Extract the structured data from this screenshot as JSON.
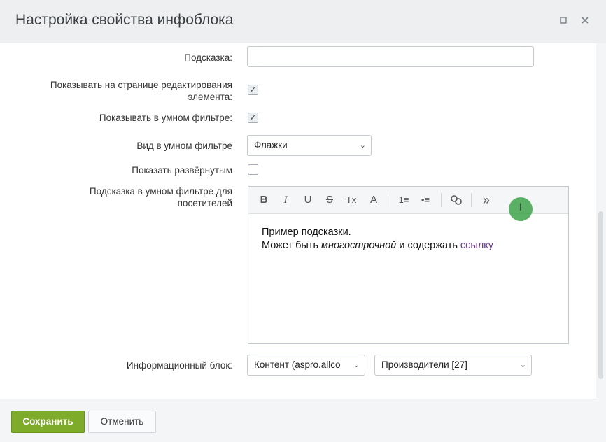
{
  "dialog": {
    "title": "Настройка свойства инфоблока",
    "maximize_icon": "maximize-icon",
    "close_icon": "close-icon"
  },
  "form": {
    "hint_label": "Подсказка:",
    "hint_value": "",
    "show_on_edit_label_line1": "Показывать на странице редактирования",
    "show_on_edit_label_line2": "элемента:",
    "show_on_edit_checked": true,
    "show_in_filter_label": "Показывать в умном фильтре:",
    "show_in_filter_checked": true,
    "filter_view_label": "Вид в умном фильтре",
    "filter_view_value": "Флажки",
    "show_expanded_label": "Показать развёрнутым",
    "show_expanded_checked": false,
    "filter_hint_label_line1": "Подсказка в умном фильтре для",
    "filter_hint_label_line2": "посетителей",
    "infoblock_label": "Информационный блок:",
    "infoblock_type_value": "Контент (aspro.allco",
    "infoblock_value": "Производители [27]"
  },
  "editor": {
    "toolbar": {
      "bold": "B",
      "italic": "I",
      "underline": "U",
      "strike": "S",
      "clear_format": "Tx",
      "font_color": "A",
      "ordered_list": "1≡",
      "unordered_list": "•≡",
      "link": "🔗",
      "more": "»"
    },
    "line1": "Пример подсказки.",
    "line2_prefix": "Может быть ",
    "line2_italic": "многострочной",
    "line2_middle": " и содержать ",
    "line2_link": "ссылку"
  },
  "buttons": {
    "save": "Сохранить",
    "cancel": "Отменить"
  },
  "colors": {
    "save_button": "#7fab2a",
    "link": "#6a3a8e",
    "cursor_highlight": "#3ea34a"
  }
}
